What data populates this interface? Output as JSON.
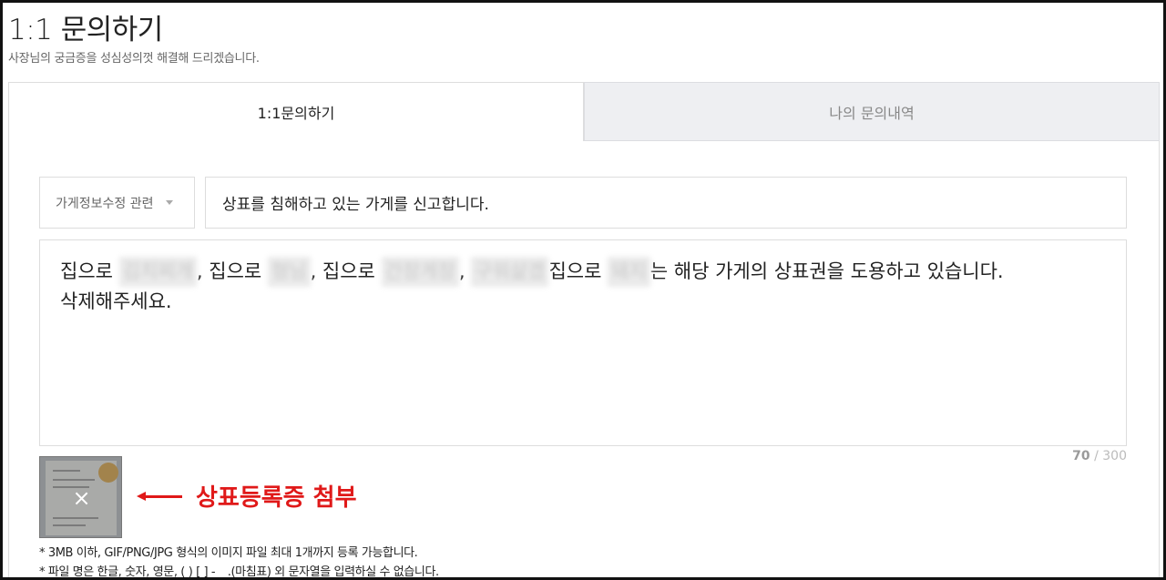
{
  "page": {
    "title": "1:1 문의하기",
    "subtitle": "사장님의 궁금증을 성심성의껏 해결해 드리겠습니다."
  },
  "tabs": [
    {
      "label": "1:1문의하기",
      "active": true
    },
    {
      "label": "나의 문의내역",
      "active": false
    }
  ],
  "form": {
    "category": "가게정보수정 관련",
    "subject": "상표를 침해하고 있는 가게를 신고합니다.",
    "body": {
      "seg1": "집으로 ",
      "blur1": "김치찌개",
      "seg2": ", 집으로 ",
      "blur2": "형님",
      "seg3": ", 집으로 ",
      "blur3": "간장게장",
      "seg4": ", ",
      "blur4": "구워삶겠",
      "seg5": "집으로 ",
      "blur5": "돼지",
      "seg6": "는 해당 가게의 상표권을 도용하고 있습니다.",
      "line2": "삭제해주세요."
    },
    "counter": {
      "current": "70",
      "separator": " / ",
      "max": "300"
    }
  },
  "attachment": {
    "remove_icon": "close-icon",
    "remove_glyph": "×",
    "annotation": "상표등록증 첨부"
  },
  "notes": [
    "* 3MB 이하, GIF/PNG/JPG 형식의 이미지 파일 최대 1개까지 등록 가능합니다.",
    "* 파일 명은 한글, 숫자, 영문, ( ) [ ] - _ .(마침표) 외 문자열을 입력하실 수 없습니다."
  ],
  "colors": {
    "accent": "#e01919",
    "inactive_tab": "#eeeff2",
    "border": "#dddddd"
  }
}
